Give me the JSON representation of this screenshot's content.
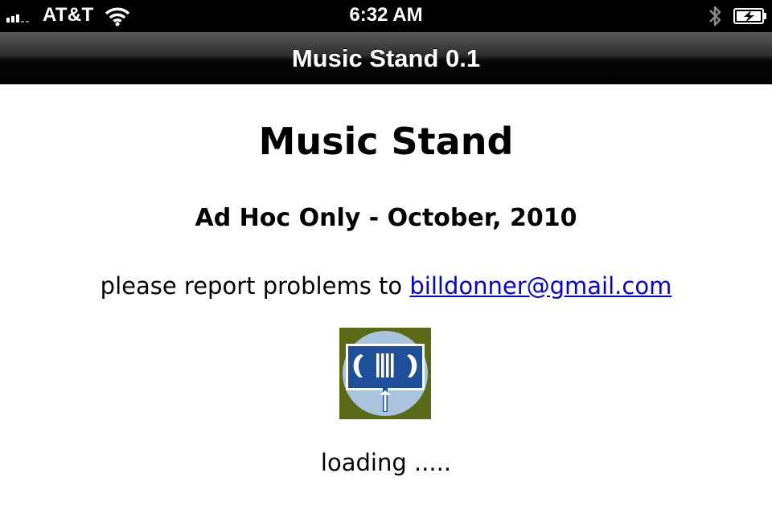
{
  "status_bar": {
    "carrier": "AT&T",
    "time": "6:32 AM",
    "icons": [
      "signal-icon",
      "wifi-icon",
      "bluetooth-icon",
      "battery-charging-icon"
    ]
  },
  "navbar": {
    "title": "Music Stand 0.1"
  },
  "main": {
    "title": "Music Stand",
    "subtitle": "Ad Hoc Only - October, 2010",
    "report_text": "please report problems to",
    "email_link": "billdonner@gmail.com",
    "logo_icon": "music-stand-logo",
    "loading_text": "loading ....."
  },
  "colors": {
    "link": "#0000ee",
    "logo_background": "#5a6b18",
    "logo_circle": "#a9c4dc",
    "logo_blue": "#1f4f9a"
  }
}
